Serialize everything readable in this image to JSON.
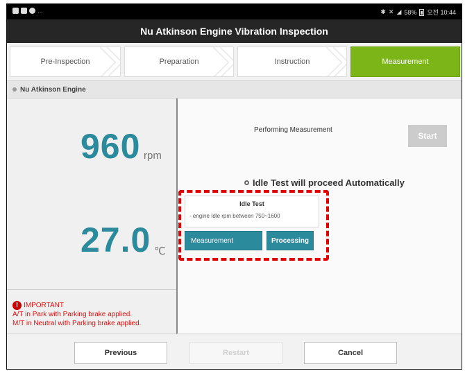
{
  "status_bar": {
    "time": "오전 10:44",
    "battery": "58%"
  },
  "title": "Nu Atkinson Engine Vibration Inspection",
  "steps": [
    {
      "label": "Pre-Inspection",
      "active": false
    },
    {
      "label": "Preparation",
      "active": false
    },
    {
      "label": "Instruction",
      "active": false
    },
    {
      "label": "Measurement",
      "active": true
    }
  ],
  "section_header": "Nu Atkinson Engine",
  "readings": {
    "rpm_value": "960",
    "rpm_unit": "rpm",
    "temp_value": "27.0",
    "temp_unit": "℃"
  },
  "important": {
    "label": "IMPORTANT",
    "lines": [
      "A/T in Park with Parking brake applied.",
      "M/T in Neutral with Parking brake applied."
    ]
  },
  "measurement": {
    "performing_label": "Performing Measurement",
    "start_button": "Start",
    "auto_message": "Idle Test will proceed Automatically",
    "test_title": "Idle Test",
    "test_description": "- engine Idle rpm between 750~1600",
    "measurement_label": "Measurement",
    "processing_label": "Processing"
  },
  "footer": {
    "previous": "Previous",
    "restart": "Restart",
    "cancel": "Cancel"
  },
  "colors": {
    "accent_teal": "#2b8a9c",
    "active_step_green": "#7cb518",
    "highlight_red": "#e10000",
    "warning_red": "#d11111"
  }
}
